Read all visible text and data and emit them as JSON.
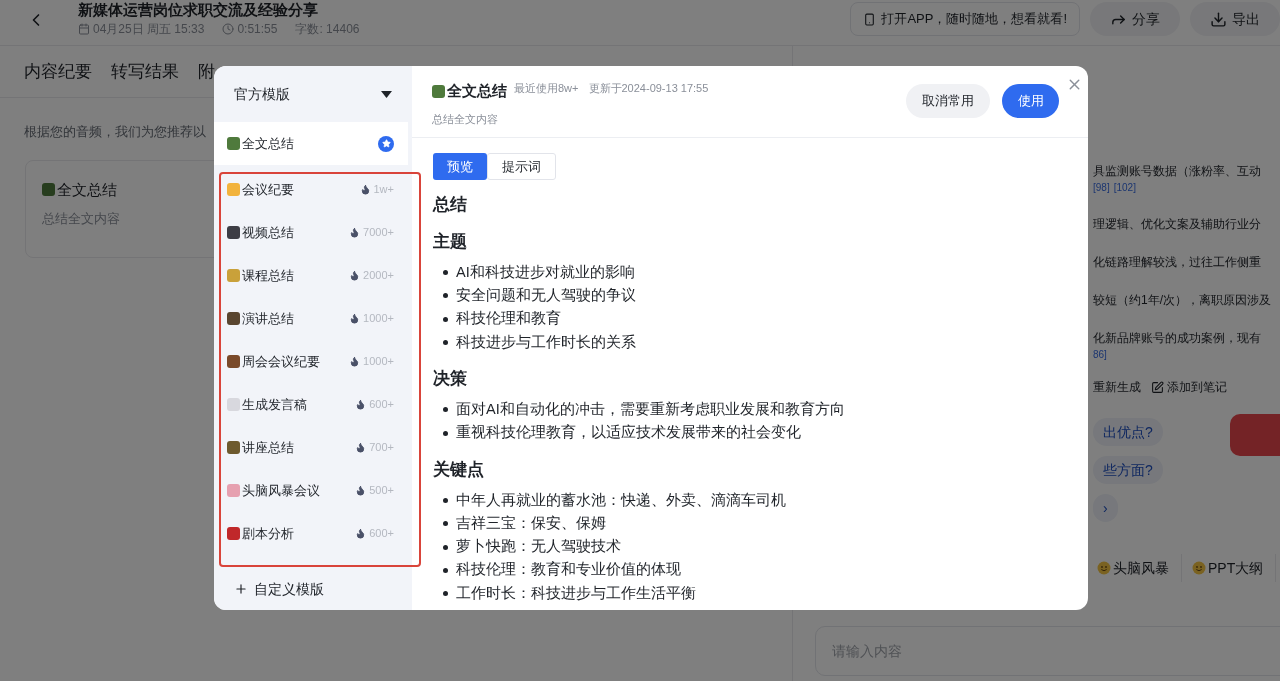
{
  "header": {
    "title": "新媒体运营岗位求职交流及经验分享",
    "date": "04月25日 周五 15:33",
    "duration": "0:51:55",
    "word_count": "字数: 14406",
    "app_banner": "打开APP，随时随地，想看就看!",
    "actions": [
      {
        "kind": "share",
        "label": "分享"
      },
      {
        "kind": "export",
        "label": "导出"
      }
    ]
  },
  "tabs": [
    "内容纪要",
    "转写结果",
    "附"
  ],
  "intro": "根据您的音频，我们为您推荐以",
  "card": {
    "title": "全文总结",
    "subtitle": "总结全文内容"
  },
  "side_panel": {
    "paragraphs": [
      {
        "text": "具监测账号数据（涨粉率、互动",
        "refs": [
          "[98]",
          "[102]"
        ]
      },
      {
        "text": "理逻辑、优化文案及辅助行业分"
      },
      {
        "text": "化链路理解较浅，过往工作侧重"
      },
      {
        "text": "较短（约1年/次），离职原因涉及"
      },
      {
        "text": "化新品牌账号的成功案例，现有",
        "refs": [
          "86]"
        ]
      }
    ],
    "actions": [
      {
        "kind": "regenerate",
        "label": "重新生成"
      },
      {
        "kind": "note",
        "label": "添加到笔记"
      }
    ],
    "suggestions": [
      "出优点?",
      "些方面?",
      "›"
    ],
    "quick_chips": [
      "头脑风暴",
      "PPT大纲"
    ],
    "input": {
      "placeholder": "请输入内容"
    }
  },
  "dialog": {
    "dropdown": "官方模版",
    "templates": [
      {
        "label": "全文总结",
        "kind": "favorite",
        "selected": true,
        "color": "#4f7a3c"
      },
      {
        "label": "会议纪要",
        "kind": "popular",
        "selected": false,
        "count": "1w+",
        "color": "#f2b33d"
      },
      {
        "label": "视频总结",
        "kind": "popular",
        "selected": false,
        "count": "7000+",
        "color": "#3d3d45"
      },
      {
        "label": "课程总结",
        "kind": "popular",
        "selected": false,
        "count": "2000+",
        "color": "#c9a13a"
      },
      {
        "label": "演讲总结",
        "kind": "popular",
        "selected": false,
        "count": "1000+",
        "color": "#5a4630"
      },
      {
        "label": "周会会议纪要",
        "kind": "popular",
        "selected": false,
        "count": "1000+",
        "color": "#7a4a2a"
      },
      {
        "label": "生成发言稿",
        "kind": "popular",
        "selected": false,
        "count": "600+",
        "color": "#d8d8de"
      },
      {
        "label": "讲座总结",
        "kind": "popular",
        "selected": false,
        "count": "700+",
        "color": "#6e5a2e"
      },
      {
        "label": "头脑风暴会议",
        "kind": "popular",
        "selected": false,
        "count": "500+",
        "color": "#e6a0b0"
      },
      {
        "label": "剧本分析",
        "kind": "popular",
        "selected": false,
        "count": "600+",
        "color": "#c0282a"
      }
    ],
    "custom": "自定义模版",
    "title": "全文总结",
    "usage": "最近使用8w+",
    "updated": "更新于2024-09-13 17:55",
    "subtitle": "总结全文内容",
    "buttons": [
      {
        "kind": "secondary",
        "label": "取消常用"
      },
      {
        "kind": "primary",
        "label": "使用"
      }
    ],
    "view_tabs": [
      {
        "label": "预览",
        "selected": true
      },
      {
        "label": "提示词",
        "selected": false
      }
    ],
    "sections": [
      {
        "heading": "总结"
      },
      {
        "heading": "主题",
        "bullets": [
          "AI和科技进步对就业的影响",
          "安全问题和无人驾驶的争议",
          "科技伦理和教育",
          "科技进步与工作时长的关系"
        ]
      },
      {
        "heading": "决策",
        "bullets": [
          "面对AI和自动化的冲击，需要重新考虑职业发展和教育方向",
          "重视科技伦理教育，以适应技术发展带来的社会变化"
        ]
      },
      {
        "heading": "关键点",
        "bullets": [
          "中年人再就业的蓄水池：快递、外卖、滴滴车司机",
          "吉祥三宝：保安、保姆",
          "萝卜快跑：无人驾驶技术",
          "科技伦理：教育和专业价值的体现",
          "工作时长：科技进步与工作生活平衡"
        ]
      }
    ]
  }
}
